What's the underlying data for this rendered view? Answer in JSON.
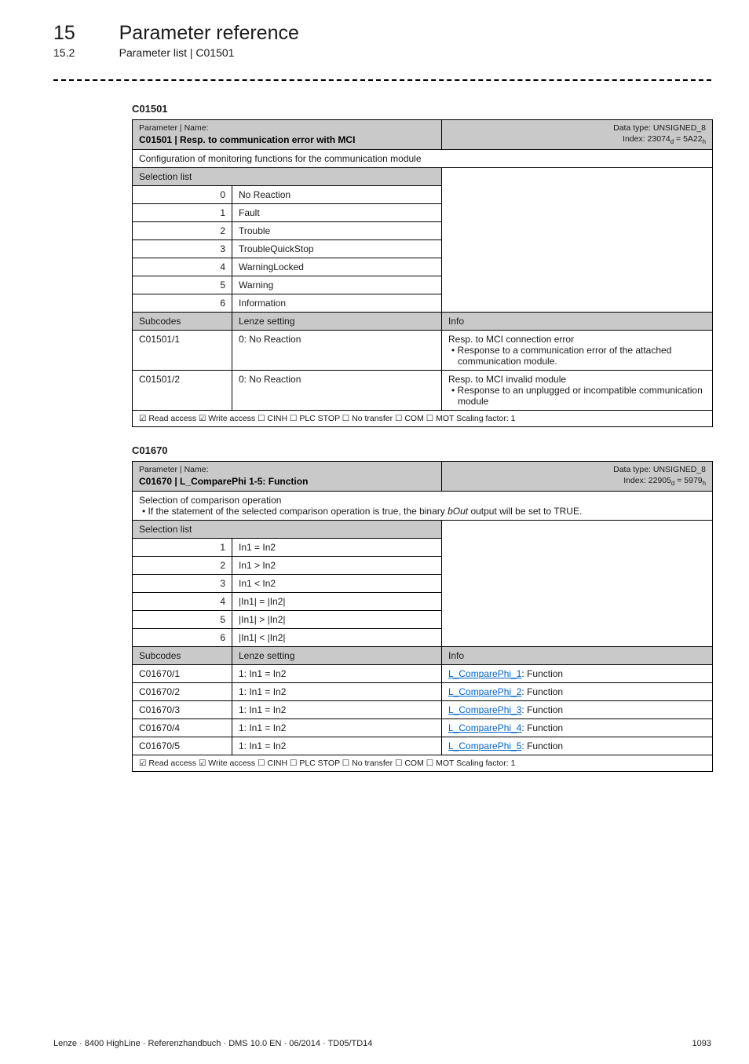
{
  "header": {
    "chapter_num": "15",
    "chapter_title": "Parameter reference",
    "section_num": "15.2",
    "section_title": "Parameter list | C01501"
  },
  "tbl1": {
    "anchor": "C01501",
    "param_label": "Parameter | Name:",
    "param_main": "C01501 | Resp. to communication error with MCI",
    "dtype": "Data type: UNSIGNED_8",
    "index": "Index: 23074",
    "index_sub1": "d",
    "index_eq": " = 5A22",
    "index_sub2": "h",
    "desc": "Configuration of monitoring functions for the communication module",
    "sel_hdr": "Selection list",
    "rows": [
      {
        "n": "0",
        "v": "No Reaction"
      },
      {
        "n": "1",
        "v": "Fault"
      },
      {
        "n": "2",
        "v": "Trouble"
      },
      {
        "n": "3",
        "v": "TroubleQuickStop"
      },
      {
        "n": "4",
        "v": "WarningLocked"
      },
      {
        "n": "5",
        "v": "Warning"
      },
      {
        "n": "6",
        "v": "Information"
      }
    ],
    "sub_hdr": {
      "a": "Subcodes",
      "b": "Lenze setting",
      "c": "Info"
    },
    "subs": [
      {
        "code": "C01501/1",
        "set": "0: No Reaction",
        "info_l1": "Resp. to MCI connection error",
        "info_b1": "Response to a communication error of the attached communication module."
      },
      {
        "code": "C01501/2",
        "set": "0: No Reaction",
        "info_l1": "Resp. to MCI invalid module",
        "info_b1": "Response to an unplugged or incompatible communication module"
      }
    ],
    "foot": "☑ Read access   ☑ Write access   ☐ CINH   ☐ PLC STOP   ☐ No transfer   ☐ COM   ☐ MOT    Scaling factor: 1"
  },
  "tbl2": {
    "anchor": "C01670",
    "param_label": "Parameter | Name:",
    "param_main": "C01670 | L_ComparePhi 1-5: Function",
    "dtype": "Data type: UNSIGNED_8",
    "index": "Index: 22905",
    "index_sub1": "d",
    "index_eq": " = 5979",
    "index_sub2": "h",
    "desc_l1": "Selection of comparison operation",
    "desc_b1_pre": "If the statement of the selected comparison operation is true, the binary ",
    "desc_b1_it": "bOut",
    "desc_b1_post": " output will be set to TRUE.",
    "sel_hdr": "Selection list",
    "rows": [
      {
        "n": "1",
        "v": "In1 = In2"
      },
      {
        "n": "2",
        "v": "In1 > In2"
      },
      {
        "n": "3",
        "v": "In1 < In2"
      },
      {
        "n": "4",
        "v": "|In1| = |In2|"
      },
      {
        "n": "5",
        "v": "|In1| > |In2|"
      },
      {
        "n": "6",
        "v": "|In1| < |In2|"
      }
    ],
    "sub_hdr": {
      "a": "Subcodes",
      "b": "Lenze setting",
      "c": "Info"
    },
    "subs": [
      {
        "code": "C01670/1",
        "set": "1: In1 = In2",
        "link": "L_ComparePhi_1",
        "suffix": ": Function"
      },
      {
        "code": "C01670/2",
        "set": "1: In1 = In2",
        "link": "L_ComparePhi_2",
        "suffix": ": Function"
      },
      {
        "code": "C01670/3",
        "set": "1: In1 = In2",
        "link": "L_ComparePhi_3",
        "suffix": ": Function"
      },
      {
        "code": "C01670/4",
        "set": "1: In1 = In2",
        "link": "L_ComparePhi_4",
        "suffix": ": Function"
      },
      {
        "code": "C01670/5",
        "set": "1: In1 = In2",
        "link": "L_ComparePhi_5",
        "suffix": ": Function"
      }
    ],
    "foot": "☑ Read access   ☑ Write access   ☐ CINH   ☐ PLC STOP   ☐ No transfer   ☐ COM   ☐ MOT    Scaling factor: 1"
  },
  "footer": {
    "left": "Lenze · 8400 HighLine · Referenzhandbuch · DMS 10.0 EN · 06/2014 · TD05/TD14",
    "right": "1093"
  }
}
